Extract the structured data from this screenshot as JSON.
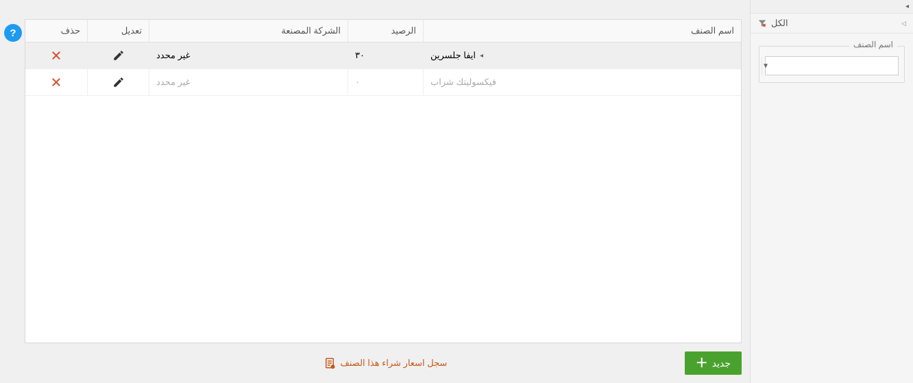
{
  "sidebar": {
    "filter_label": "الكل",
    "field_label": "اسم الصنف",
    "field_value": ""
  },
  "grid": {
    "headers": {
      "name": "اسم الصنف",
      "balance": "الرصيد",
      "company": "الشركة المصنعة",
      "edit": "تعديل",
      "delete": "حذف"
    },
    "rows": [
      {
        "name": "ايفا جلسرين",
        "balance": "٣٠",
        "company": "غير محدد",
        "selected": true
      },
      {
        "name": "فيكسوليتك شراب",
        "balance": "٠",
        "company": "غير محدد",
        "selected": false
      }
    ]
  },
  "footer": {
    "history_link": "سجل اسعار شراء هذا الصنف",
    "new_label": "جديد"
  },
  "help": "?",
  "colors": {
    "accent": "#c65a1a",
    "green": "#4aa22e",
    "blue": "#1e9bf0",
    "delete": "#d64b2e",
    "edit": "#333"
  }
}
